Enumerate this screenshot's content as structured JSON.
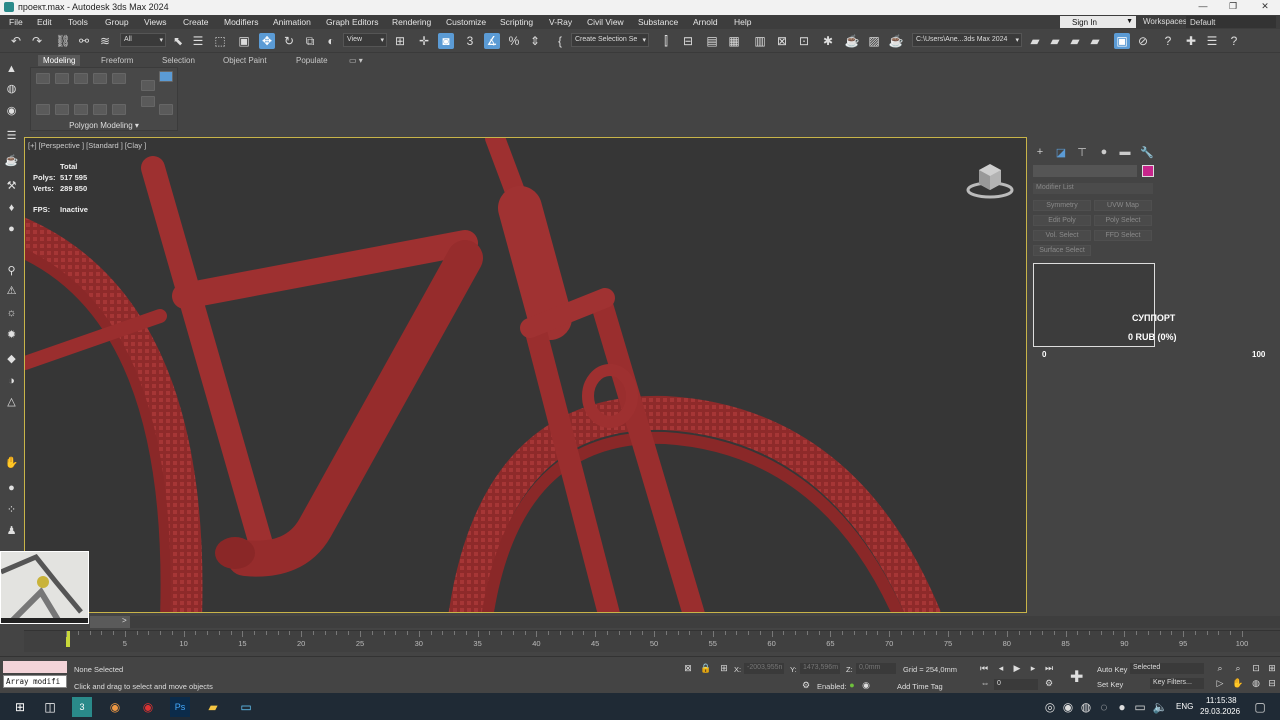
{
  "window": {
    "title": "проект.max - Autodesk 3ds Max 2024",
    "minimize": "—",
    "maximize": "❐",
    "close": "✕"
  },
  "menu": {
    "items": [
      "File",
      "Edit",
      "Tools",
      "Group",
      "Views",
      "Create",
      "Modifiers",
      "Animation",
      "Graph Editors",
      "Rendering",
      "Customize",
      "Scripting",
      "V-Ray",
      "Civil View",
      "Substance",
      "Arnold",
      "Help"
    ],
    "sign_in": "Sign In",
    "workspaces_label": "Workspaces:",
    "workspaces_value": "Default"
  },
  "toolbar": {
    "selection_filter": "All",
    "ref_coord": "View",
    "named_selection": "Create Selection Se",
    "project_path": "C:\\Users\\Ane...3ds Max 2024"
  },
  "ribbon": {
    "tabs": [
      "Modeling",
      "Freeform",
      "Selection",
      "Object Paint",
      "Populate"
    ],
    "active_tab": "Modeling",
    "panel_label": "Polygon Modeling ▾"
  },
  "viewport": {
    "label": "[+] [Perspective ] [Standard ] [Clay ]",
    "stats_header": "Total",
    "polys_label": "Polys:",
    "polys_value": "517 595",
    "verts_label": "Verts:",
    "verts_value": "289 850",
    "fps_label": "FPS:",
    "fps_value": "Inactive",
    "model_color": "#9a2e2e",
    "bg_color": "#363636"
  },
  "command_panel": {
    "modifier_list": "Modifier List",
    "object_color": "#c8268c",
    "modifier_buttons": [
      "Symmetry",
      "UVW Map",
      "Edit Poly",
      "Poly Select",
      "Vol. Select",
      "FFD Select",
      "Surface Select"
    ],
    "support_title": "СУППОРТ",
    "support_value": "0 RUB (0%)",
    "range_min": "0",
    "range_max": "100"
  },
  "timeline": {
    "frame_display": "0 / 100",
    "ticks": [
      "5",
      "10",
      "15",
      "20",
      "25",
      "30",
      "35",
      "40",
      "45",
      "50",
      "55",
      "60",
      "65",
      "70",
      "75",
      "80",
      "85",
      "90",
      "95",
      "100"
    ]
  },
  "status": {
    "maxscript": "Array modifi",
    "selection": "None Selected",
    "prompt": "Click and drag to select and move objects",
    "x_label": "X:",
    "x_value": "-2003,955n",
    "y_label": "Y:",
    "y_value": "1473,596m",
    "z_label": "Z:",
    "z_value": "0,0mm",
    "grid": "Grid = 254,0mm",
    "enabled_label": "Enabled:",
    "add_time_tag": "Add Time Tag",
    "frame_field": "0",
    "auto_key": "Auto Key",
    "set_key": "Set Key",
    "selected_dropdown": "Selected",
    "key_filters": "Key Filters..."
  },
  "taskbar": {
    "lang": "ENG",
    "time": "11:15:38",
    "date": "29.03.2026"
  }
}
